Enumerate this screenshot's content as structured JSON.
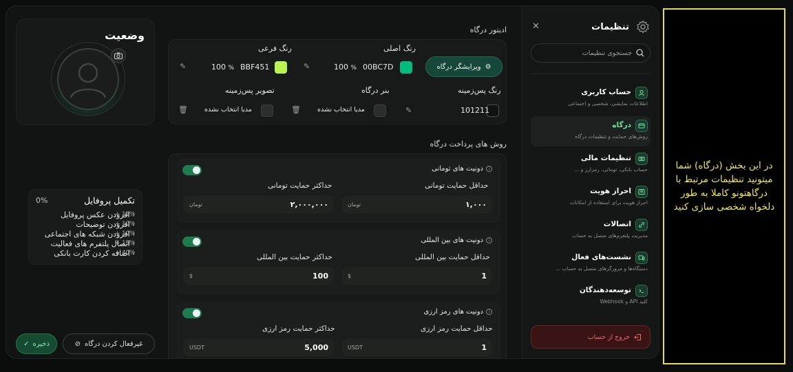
{
  "status": {
    "title": "وضعیت",
    "profile_completion": {
      "title": "تکمیل پروفایل",
      "percent": "0%",
      "items": [
        {
          "label": "افزودن عکس پروفایل",
          "value": "15% +"
        },
        {
          "label": "افزودن توضیحات",
          "value": "10% +"
        },
        {
          "label": "افزودن شبکه های اجتماعی",
          "value": "10% +"
        },
        {
          "label": "اتصال پلتفرم های فعالیت",
          "value": "15% +"
        },
        {
          "label": "اضافه کردن کارت بانکی",
          "value": "40% +"
        }
      ]
    },
    "save_label": "ذخیره",
    "disable_label": "غیرفعال کردن درگاه"
  },
  "editor": {
    "section_title": "ادیتور درگاه",
    "visual_editor_label": "ویرایشگر درگاه",
    "primary_color": {
      "label": "رنگ اصلی",
      "hex": "00BC7D",
      "opacity": "100",
      "opacity_unit": "%",
      "swatch": "#00BC7D"
    },
    "secondary_color": {
      "label": "رنگ فرعی",
      "hex": "BBF451",
      "opacity": "100",
      "opacity_unit": "%",
      "swatch": "#BBF451"
    },
    "background_color": {
      "label": "رنگ پس‌زمینه",
      "hex": "101211",
      "swatch": "#101211"
    },
    "banner": {
      "label": "بنر درگاه",
      "value": "مدیا انتخاب نشده"
    },
    "background_image": {
      "label": "تصویر پس‌زمینه",
      "value": "مدیا انتخاب نشده"
    }
  },
  "payment": {
    "section_title": "روش های پرداخت درگاه",
    "methods": [
      {
        "title": "دونیت های تومانی",
        "enabled": true,
        "min_label": "حداقل حمایت تومانی",
        "min_value": "۱,۰۰۰",
        "min_unit": "تومان",
        "max_label": "حداکثر حمایت تومانی",
        "max_value": "۲,۰۰۰,۰۰۰",
        "max_unit": "تومان"
      },
      {
        "title": "دونیت های بین المللی",
        "enabled": true,
        "min_label": "حداقل حمایت بین المللی",
        "min_value": "1",
        "min_unit": "$",
        "max_label": "حداکثر حمایت بین المللی",
        "max_value": "100",
        "max_unit": "$"
      },
      {
        "title": "دونیت های رمز ارزی",
        "enabled": true,
        "min_label": "حداقل حمایت رمز ارزی",
        "min_value": "1",
        "min_unit": "USDT",
        "max_label": "حداکثر حمایت رمز ارزی",
        "max_value": "5,000",
        "max_unit": "USDT"
      }
    ]
  },
  "settings": {
    "title": "تنظیمات",
    "search_placeholder": "جستجوی تنظیمات",
    "menu": [
      {
        "title": "حساب کاربری",
        "subtitle": "اطلاعات نمایشی، شخصی و اجتماعی",
        "icon": "user-icon"
      },
      {
        "title": "درگاه",
        "subtitle": "روش‌های حمایت و تنظیمات درگاه",
        "icon": "gateway-icon"
      },
      {
        "title": "تنظیمات مالی",
        "subtitle": "حساب بانکی، تومانی، رمزارز و ...",
        "icon": "finance-icon"
      },
      {
        "title": "احراز هویت",
        "subtitle": "احراز هویت برای استفاده از امکانات",
        "icon": "id-icon"
      },
      {
        "title": "اتصالات",
        "subtitle": "مدیریت پلتفرم‌های متصل به حساب",
        "icon": "link-icon"
      },
      {
        "title": "نشست‌های فعال",
        "subtitle": "دستگاه‌ها و مرورگرهای متصل به حساب ...",
        "icon": "session-icon"
      },
      {
        "title": "توسعه‌دهندگان",
        "subtitle": "کلید API و Webhook",
        "icon": "code-icon"
      }
    ],
    "logout_label": "خروج از حساب"
  },
  "annotation": {
    "text": "در این بخش (درگاه) شما میتونید تنظیمات مرتبط با درگاهتونو کاملا به طور دلخواه شخصی سازی کنید"
  }
}
